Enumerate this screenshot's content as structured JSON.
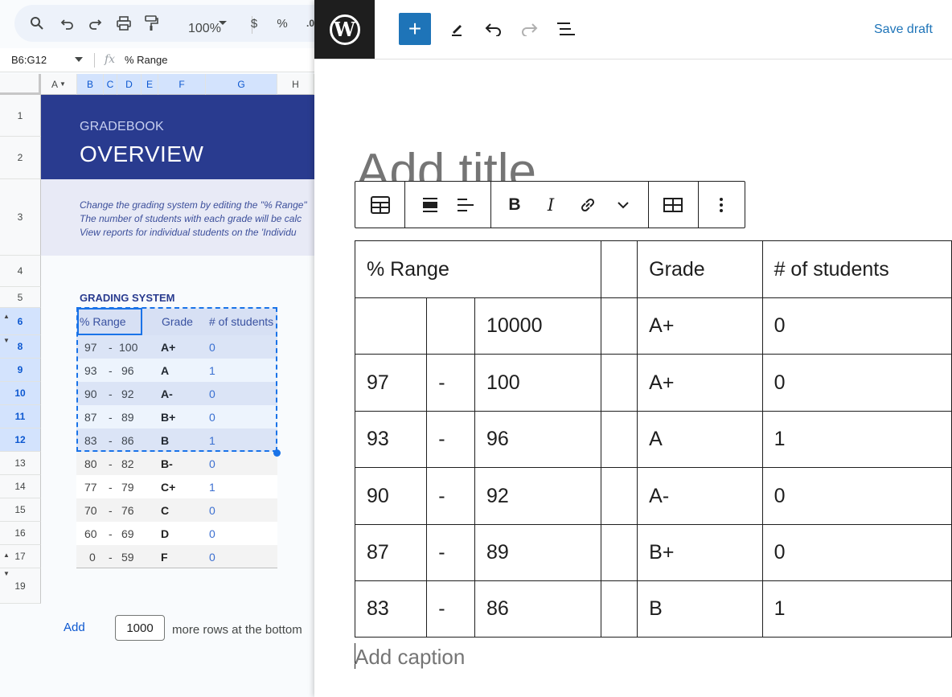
{
  "sheets": {
    "toolbar": {
      "zoom": "100%",
      "currency": "$",
      "percent": "%",
      "decimal": ".0"
    },
    "formula_bar": {
      "name_box": "B6:G12",
      "fx": "fx",
      "value": "% Range"
    },
    "columns": [
      "A",
      "B",
      "C",
      "D",
      "E",
      "F",
      "G",
      "H"
    ],
    "rows": [
      "1",
      "2",
      "3",
      "4",
      "5",
      "6",
      "8",
      "9",
      "10",
      "11",
      "12",
      "13",
      "14",
      "15",
      "16",
      "17",
      "19"
    ],
    "banner": {
      "subtitle": "GRADEBOOK",
      "title": "OVERVIEW"
    },
    "notes": [
      "Change the grading system by editing the \"% Range\"",
      "The number of students with each grade will be calc",
      "View reports for individual students on the 'Individu"
    ],
    "grading_system": {
      "title": "GRADING SYSTEM",
      "headers": {
        "range": "% Range",
        "grade": "Grade",
        "count": "# of students"
      },
      "rows": [
        {
          "lo": "97",
          "dash": "-",
          "hi": "100",
          "grade": "A+",
          "count": "0"
        },
        {
          "lo": "93",
          "dash": "-",
          "hi": "96",
          "grade": "A",
          "count": "1"
        },
        {
          "lo": "90",
          "dash": "-",
          "hi": "92",
          "grade": "A-",
          "count": "0"
        },
        {
          "lo": "87",
          "dash": "-",
          "hi": "89",
          "grade": "B+",
          "count": "0"
        },
        {
          "lo": "83",
          "dash": "-",
          "hi": "86",
          "grade": "B",
          "count": "1"
        },
        {
          "lo": "80",
          "dash": "-",
          "hi": "82",
          "grade": "B-",
          "count": "0"
        },
        {
          "lo": "77",
          "dash": "-",
          "hi": "79",
          "grade": "C+",
          "count": "1"
        },
        {
          "lo": "70",
          "dash": "-",
          "hi": "76",
          "grade": "C",
          "count": "0"
        },
        {
          "lo": "60",
          "dash": "-",
          "hi": "69",
          "grade": "D",
          "count": "0"
        },
        {
          "lo": "0",
          "dash": "-",
          "hi": "59",
          "grade": "F",
          "count": "0"
        }
      ]
    },
    "footer": {
      "add_label": "Add",
      "rows_value": "1000",
      "suffix": "more rows at the bottom"
    }
  },
  "wordpress": {
    "logo_letter": "W",
    "add_icon": "+",
    "save_draft": "Save draft",
    "title_placeholder": "Add title",
    "table": [
      [
        "% Range",
        "",
        "",
        "",
        "Grade",
        "# of students"
      ],
      [
        "",
        "",
        "10000",
        "",
        "A+",
        "0"
      ],
      [
        "97",
        "-",
        "100",
        "",
        "A+",
        "0"
      ],
      [
        "93",
        "-",
        "96",
        "",
        "A",
        "1"
      ],
      [
        "90",
        "-",
        "92",
        "",
        "A-",
        "0"
      ],
      [
        "87",
        "-",
        "89",
        "",
        "B+",
        "0"
      ],
      [
        "83",
        "-",
        "86",
        "",
        "B",
        "1"
      ]
    ],
    "caption_placeholder": "Add caption",
    "toolbar_icons": [
      "table-icon",
      "align-icon",
      "text-align-icon",
      "bold-icon",
      "italic-icon",
      "link-icon",
      "chevron-down-icon",
      "edit-table-icon",
      "more-options-icon"
    ]
  }
}
